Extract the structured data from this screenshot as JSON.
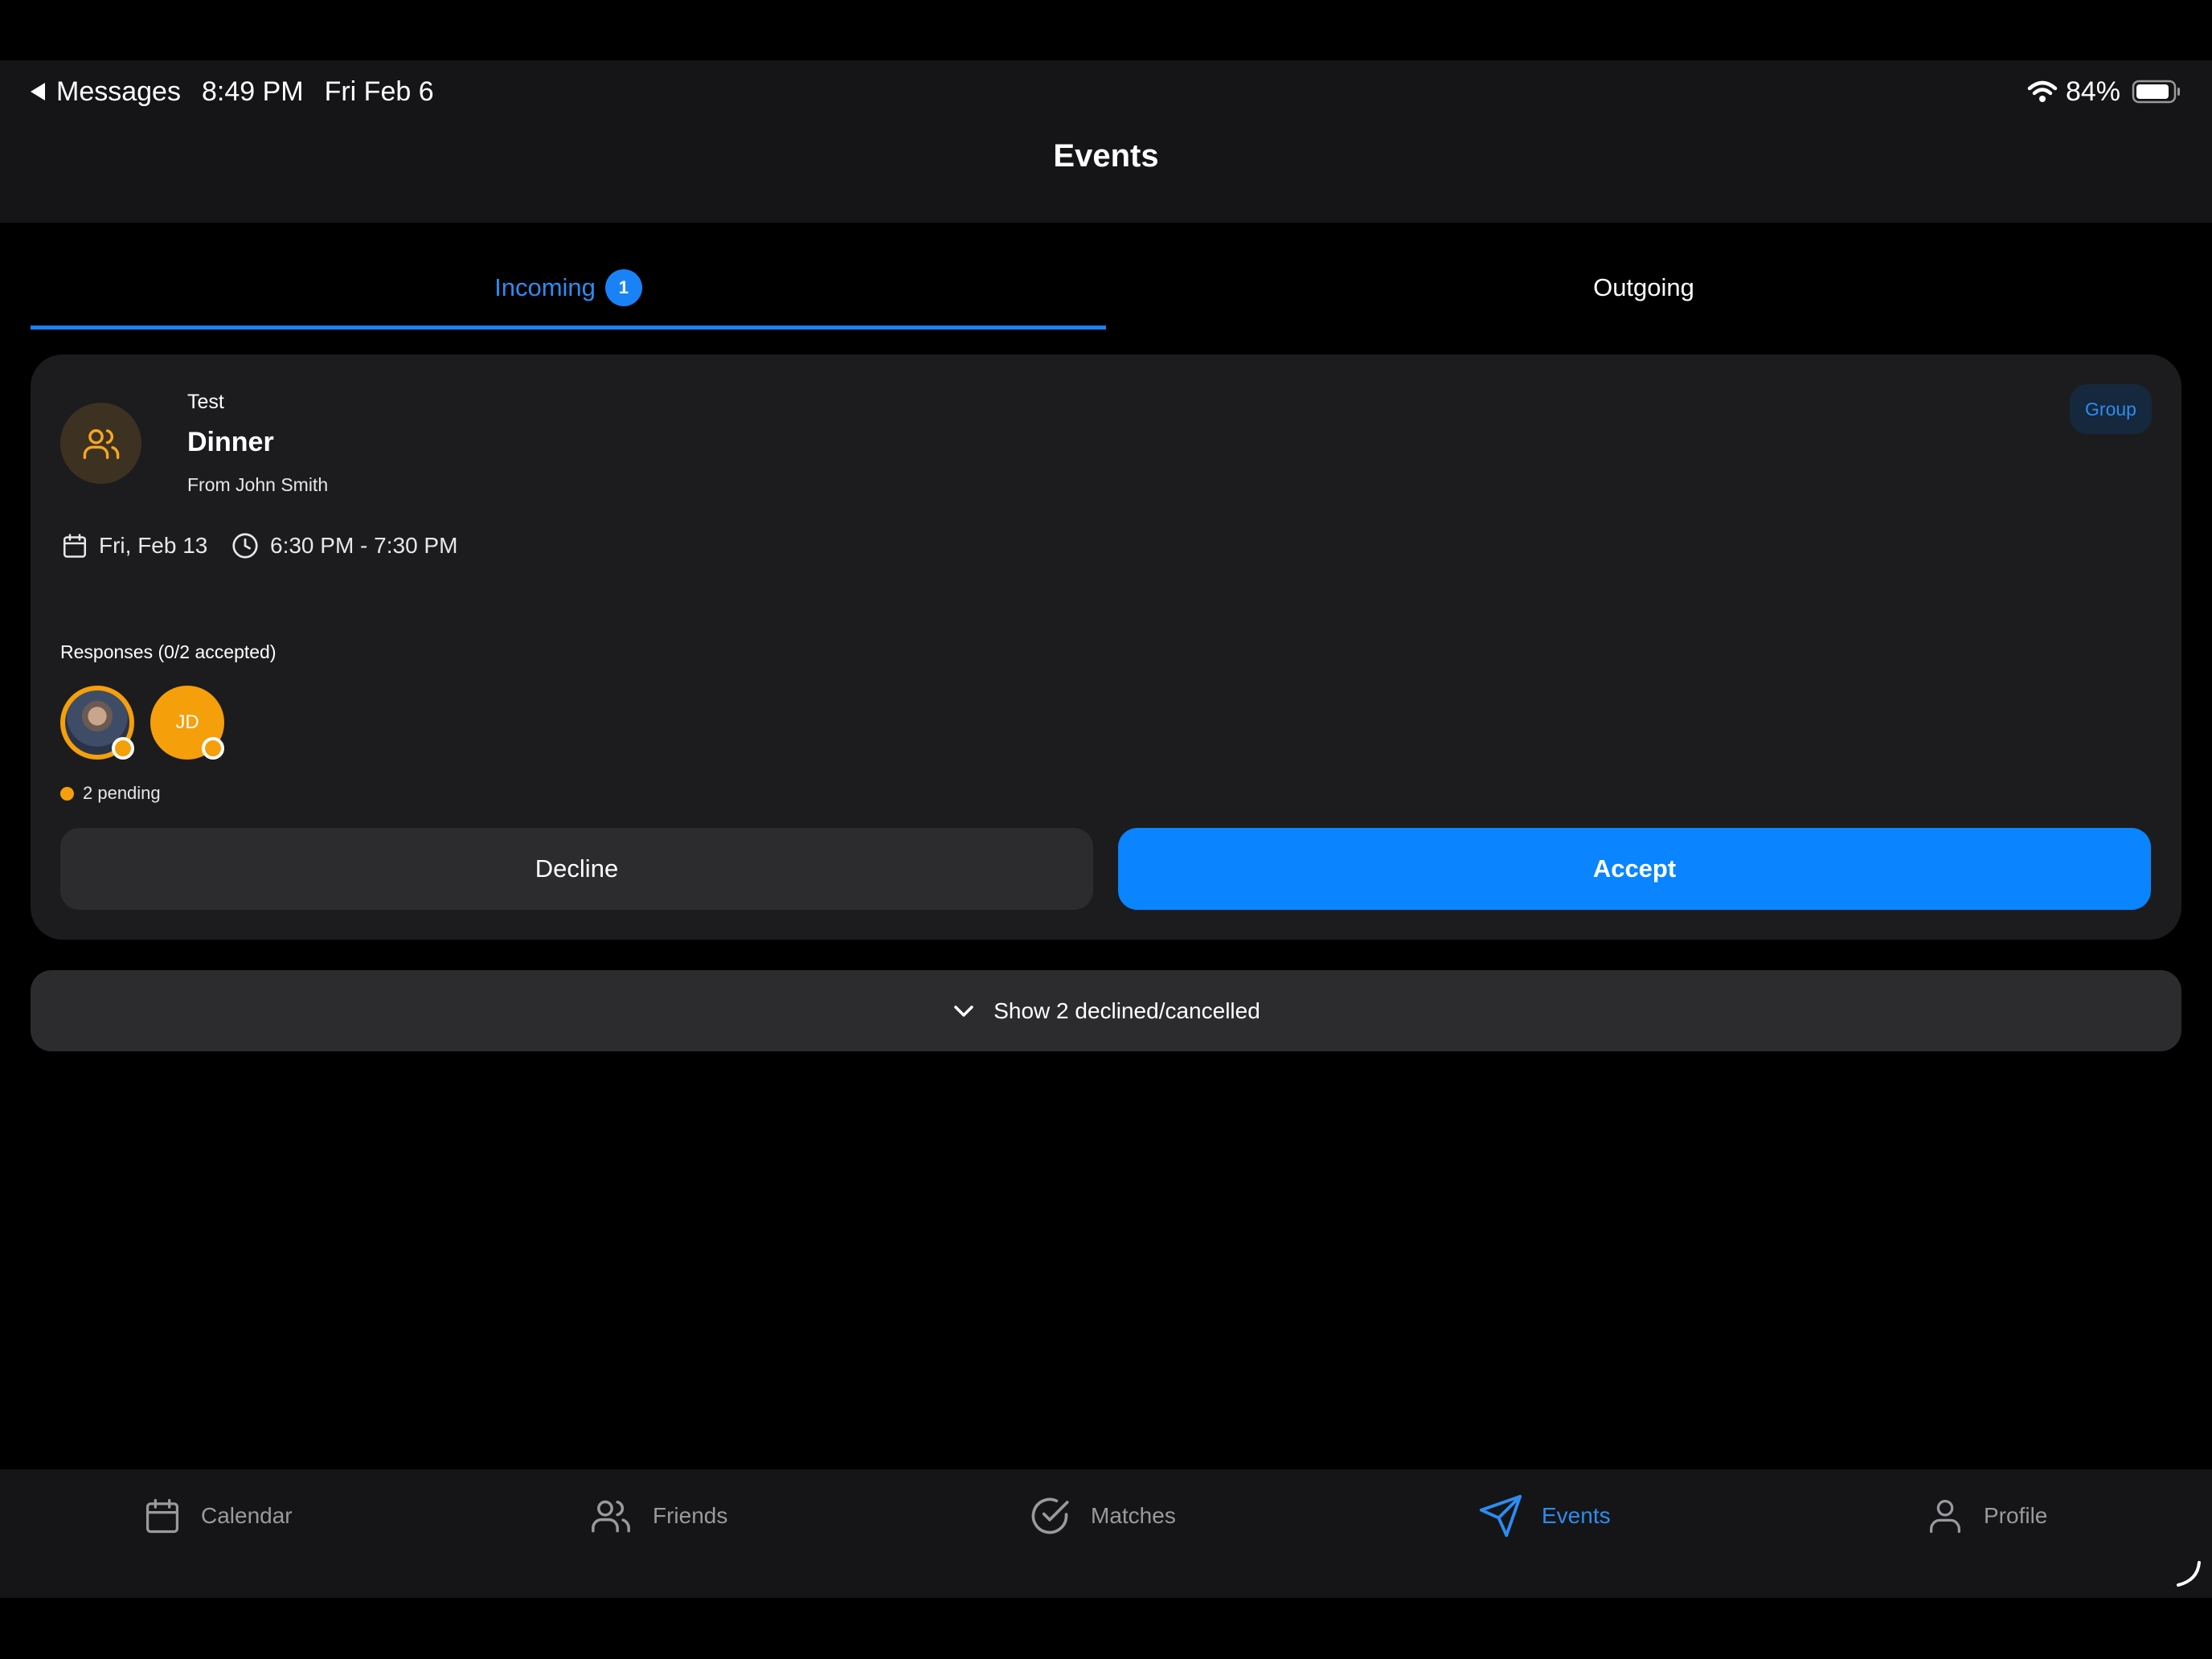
{
  "status_bar": {
    "back_app": "Messages",
    "time": "8:49 PM",
    "date": "Fri Feb 6",
    "battery": "84%"
  },
  "header": {
    "title": "Events"
  },
  "tabs": [
    {
      "label": "Incoming",
      "badge": "1",
      "active": true
    },
    {
      "label": "Outgoing",
      "active": false
    }
  ],
  "event": {
    "subtitle": "Test",
    "title": "Dinner",
    "from": "From John Smith",
    "type_badge": "Group",
    "date": "Fri, Feb 13",
    "time": "6:30 PM - 7:30 PM",
    "responses_label": "Responses (0/2 accepted)",
    "responders": [
      {
        "kind": "photo",
        "icon": "person-photo"
      },
      {
        "kind": "initials",
        "initials": "JD"
      }
    ],
    "pending_label": "2 pending",
    "decline_label": "Decline",
    "accept_label": "Accept"
  },
  "declined_toggle": {
    "label": "Show 2 declined/cancelled"
  },
  "bottom_nav": [
    {
      "label": "Calendar",
      "icon": "calendar-icon"
    },
    {
      "label": "Friends",
      "icon": "users-icon"
    },
    {
      "label": "Matches",
      "icon": "check-circle-icon"
    },
    {
      "label": "Events",
      "icon": "send-icon",
      "active": true
    },
    {
      "label": "Profile",
      "icon": "user-icon"
    }
  ],
  "colors": {
    "accent": "#0a84ff",
    "pending": "#f59f0a",
    "card": "#1c1c1e",
    "background": "#000000"
  }
}
